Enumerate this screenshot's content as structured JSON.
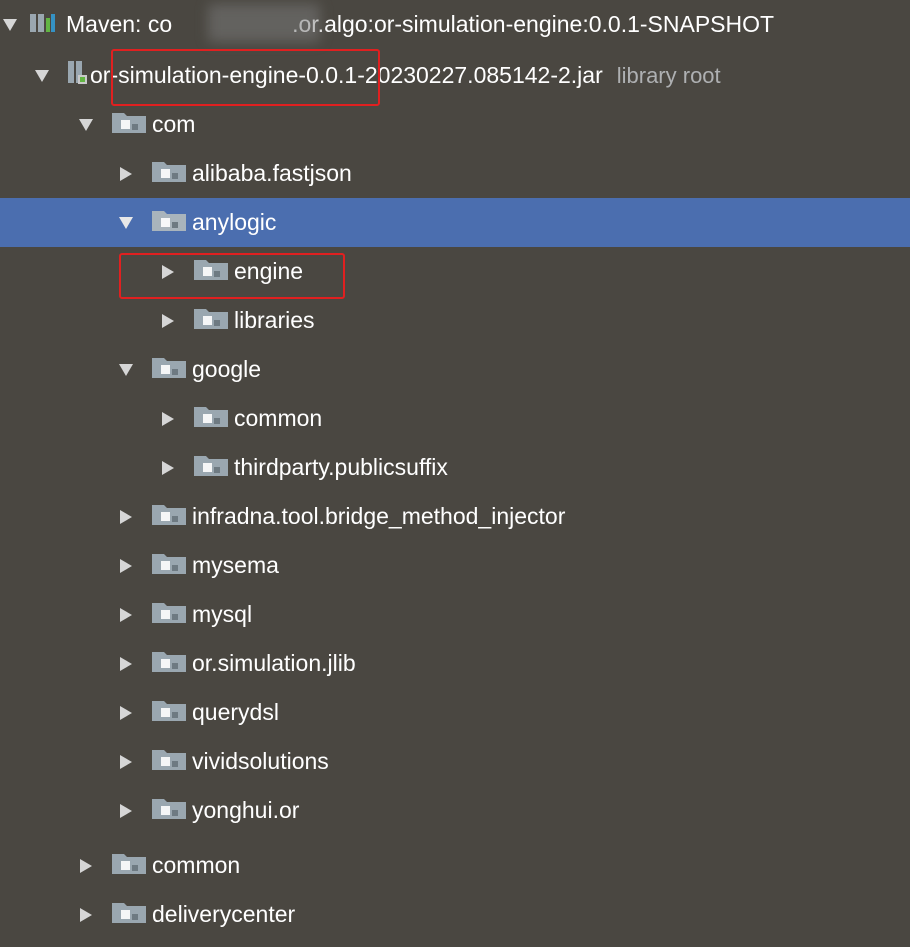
{
  "tree": {
    "root": {
      "prefix": "Maven: co",
      "suffix": ".or.algo:or-simulation-engine:0.0.1-SNAPSHOT",
      "expanded": true,
      "icon": "maven-library-icon"
    },
    "jar": {
      "label": "or-simulation-engine-0.0.1-20230227.085142-2.jar",
      "hint": "library root",
      "expanded": true,
      "icon": "jar-icon"
    },
    "nodes": [
      {
        "label": "com",
        "expanded": true
      },
      {
        "label": "alibaba.fastjson",
        "expanded": false
      },
      {
        "label": "anylogic",
        "expanded": true,
        "selected": true
      },
      {
        "label": "engine",
        "expanded": false
      },
      {
        "label": "libraries",
        "expanded": false
      },
      {
        "label": "google",
        "expanded": true
      },
      {
        "label": "common",
        "expanded": false
      },
      {
        "label": "thirdparty.publicsuffix",
        "expanded": false
      },
      {
        "label": "infradna.tool.bridge_method_injector",
        "expanded": false
      },
      {
        "label": "mysema",
        "expanded": false
      },
      {
        "label": "mysql",
        "expanded": false
      },
      {
        "label": "or.simulation.jlib",
        "expanded": false
      },
      {
        "label": "querydsl",
        "expanded": false
      },
      {
        "label": "vividsolutions",
        "expanded": false
      },
      {
        "label": "yonghui.or",
        "expanded": false
      },
      {
        "label": "common",
        "expanded": false
      },
      {
        "label": "deliverycenter",
        "expanded": false
      }
    ]
  },
  "colors": {
    "background": "#4a4741",
    "selection": "#4b6eaf",
    "text": "#ffffff",
    "hint": "#aeb0b2",
    "highlight_box": "#e02020",
    "package_icon": "#9aa7b0"
  }
}
